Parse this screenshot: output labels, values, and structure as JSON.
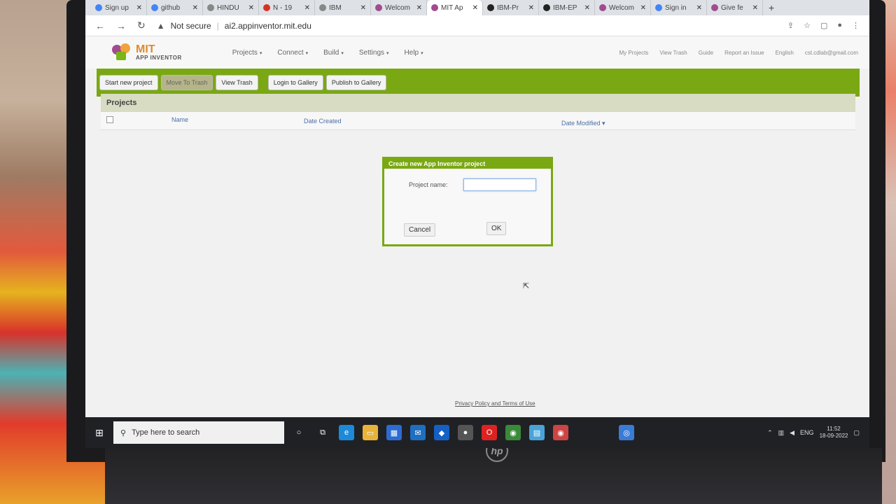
{
  "browser": {
    "tabs": [
      {
        "label": "Sign up",
        "icon": "g"
      },
      {
        "label": "github",
        "icon": "g"
      },
      {
        "label": "HINDU",
        "icon": "globe"
      },
      {
        "label": "N - 19",
        "icon": "m"
      },
      {
        "label": "IBM",
        "icon": "globe"
      },
      {
        "label": "Welcom",
        "icon": "ai"
      },
      {
        "label": "MIT Ap",
        "icon": "ai"
      },
      {
        "label": "IBM-Pr",
        "icon": "gh"
      },
      {
        "label": "IBM-EP",
        "icon": "gh"
      },
      {
        "label": "Welcom",
        "icon": "ai"
      },
      {
        "label": "Sign in",
        "icon": "g"
      },
      {
        "label": "Give fe",
        "icon": "ai"
      }
    ],
    "new_tab": "+",
    "not_secure": "Not secure",
    "url": "ai2.appinventor.mit.edu"
  },
  "app": {
    "logo_mit": "MIT",
    "logo_sub": "APP INVENTOR",
    "menu": [
      "Projects",
      "Connect",
      "Build",
      "Settings",
      "Help"
    ],
    "right_links": [
      "My Projects",
      "View Trash",
      "Guide",
      "Report an Issue",
      "English",
      "cst.cdlab@gmail.com"
    ]
  },
  "toolbar": {
    "start_new": "Start new project",
    "move_trash": "Move To Trash",
    "view_trash": "View Trash",
    "login_gallery": "Login to Gallery",
    "publish_gallery": "Publish to Gallery"
  },
  "projects": {
    "title": "Projects",
    "col_name": "Name",
    "col_created": "Date Created",
    "col_modified": "Date Modified ▾"
  },
  "dialog": {
    "title": "Create new App Inventor project",
    "label": "Project name:",
    "value": "",
    "cancel": "Cancel",
    "ok": "OK"
  },
  "footer": "Privacy Policy and Terms of Use",
  "taskbar": {
    "search_placeholder": "Type here to search",
    "lang": "ENG",
    "time": "11:52",
    "date": "18-09-2022"
  }
}
